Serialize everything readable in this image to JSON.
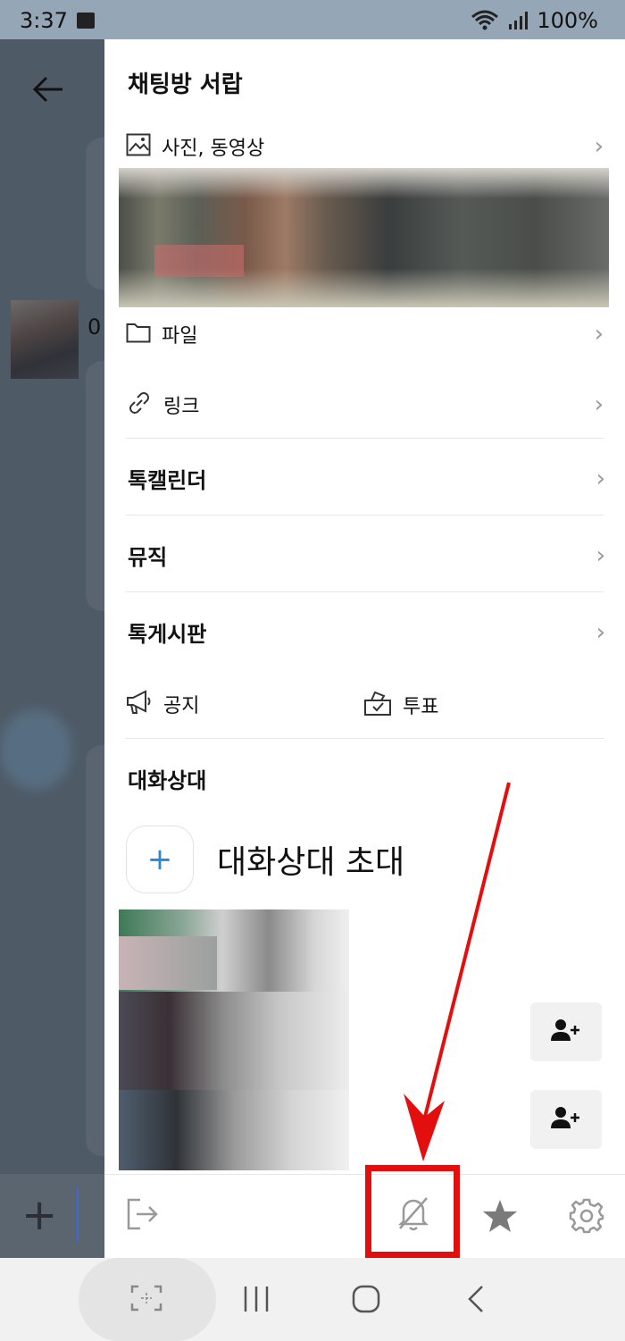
{
  "status_bar": {
    "time": "3:37",
    "battery": "100%"
  },
  "chat_bg": {
    "preview_text": "0"
  },
  "drawer": {
    "title": "채팅방 서랍",
    "photos_label": "사진, 동영상",
    "files_label": "파일",
    "links_label": "링크",
    "calendar_label": "톡캘린더",
    "music_label": "뮤직",
    "board_label": "톡게시판",
    "notice_label": "공지",
    "vote_label": "투표",
    "participants_title": "대화상대",
    "invite_label": "대화상대 초대"
  },
  "colors": {
    "accent": "#2b86d6",
    "highlight": "#e30e0e",
    "arrow": "#e30e0e"
  }
}
